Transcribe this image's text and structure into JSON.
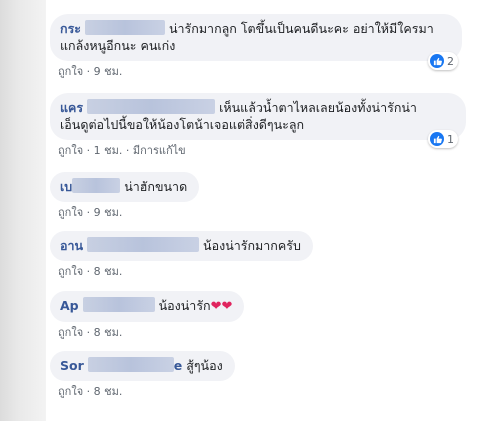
{
  "comments": [
    {
      "name": "กระ",
      "text": "น่ารักมากลูก โตขึ้นเป็นคนดีนะคะ อย่าให้มีใครมา",
      "text2": "แกล้งหนูอีกนะ คนเก่ง",
      "like": "ถูกใจ",
      "time": "9 ชม.",
      "reactions": "2"
    },
    {
      "name": "แคร",
      "text": "เห็นแล้วน้ำตาไหลเลยน้องทั้งน่ารักน่า",
      "text2": "เอ็นดูต่อไปนี้ขอให้น้องโตน้าเจอแต่สิ่งดีๆนะลูก",
      "like": "ถูกใจ",
      "time": "1 ชม.",
      "edited": "มีการแก้ไข",
      "reactions": "1"
    },
    {
      "name": "เบ",
      "text": "น่าฮักขนาด",
      "like": "ถูกใจ",
      "time": "9 ชม."
    },
    {
      "name": "อาน",
      "text": "น้องน่ารักมากครับ",
      "like": "ถูกใจ",
      "time": "8 ชม."
    },
    {
      "name": "Ap",
      "text": "น้องน่ารัก",
      "hearts": "❤❤",
      "like": "ถูกใจ",
      "time": "8 ชม."
    },
    {
      "name": "Sor",
      "text": "สู้ๆน้อง",
      "name_suffix": "e",
      "like": "ถูกใจ",
      "time": "8 ชม."
    }
  ],
  "colors": {
    "bubble": "#f1f2f6",
    "name": "#385898",
    "meta": "#606770",
    "like_blue": "#1877f2"
  },
  "icons": [
    "like-icon",
    "heart-emoji"
  ]
}
